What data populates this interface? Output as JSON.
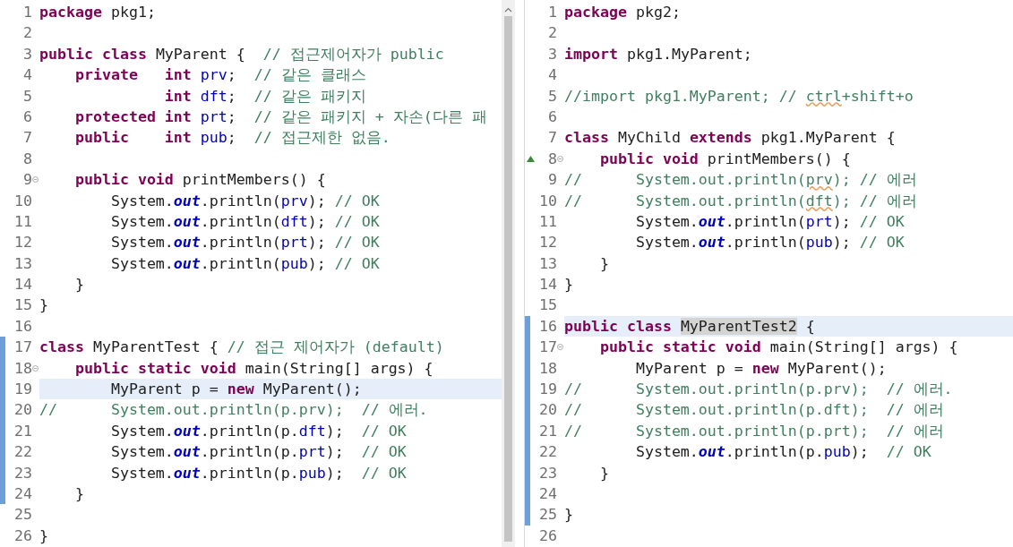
{
  "editors": [
    {
      "scrollbar": true,
      "lines": [
        {
          "number": "1",
          "highlighted": false,
          "changed": false,
          "fold": false,
          "override": false,
          "tokens": [
            {
              "kind": "keyword",
              "text": "package"
            },
            {
              "kind": "plain",
              "text": " pkg1;"
            }
          ]
        },
        {
          "number": "2",
          "highlighted": false,
          "changed": false,
          "fold": false,
          "override": false
        },
        {
          "number": "3",
          "highlighted": false,
          "changed": false,
          "fold": false,
          "override": false,
          "tokens": [
            {
              "kind": "keyword",
              "text": "public class"
            },
            {
              "kind": "plain",
              "text": " MyParent {  "
            },
            {
              "kind": "comment",
              "text": "// 접근제어자가 public"
            }
          ]
        },
        {
          "number": "4",
          "highlighted": false,
          "changed": false,
          "fold": false,
          "override": false,
          "tokens": [
            {
              "kind": "keyword",
              "text": "    private   int "
            },
            {
              "kind": "field",
              "text": "prv"
            },
            {
              "kind": "plain",
              "text": ";  "
            },
            {
              "kind": "comment",
              "text": "// 같은 클래스"
            }
          ]
        },
        {
          "number": "5",
          "highlighted": false,
          "changed": false,
          "fold": false,
          "override": false,
          "tokens": [
            {
              "kind": "keyword",
              "text": "              int "
            },
            {
              "kind": "field",
              "text": "dft"
            },
            {
              "kind": "plain",
              "text": ";  "
            },
            {
              "kind": "comment",
              "text": "// 같은 패키지"
            }
          ]
        },
        {
          "number": "6",
          "highlighted": false,
          "changed": false,
          "fold": false,
          "override": false,
          "tokens": [
            {
              "kind": "keyword",
              "text": "    protected int "
            },
            {
              "kind": "field",
              "text": "prt"
            },
            {
              "kind": "plain",
              "text": ";  "
            },
            {
              "kind": "comment",
              "text": "// 같은 패키지 + 자손(다른 패"
            }
          ]
        },
        {
          "number": "7",
          "highlighted": false,
          "changed": false,
          "fold": false,
          "override": false,
          "tokens": [
            {
              "kind": "keyword",
              "text": "    public    int "
            },
            {
              "kind": "field",
              "text": "pub"
            },
            {
              "kind": "plain",
              "text": ";  "
            },
            {
              "kind": "comment",
              "text": "// 접근제한 없음."
            }
          ]
        },
        {
          "number": "8",
          "highlighted": false,
          "changed": false,
          "fold": false,
          "override": false
        },
        {
          "number": "9",
          "highlighted": false,
          "changed": false,
          "fold": true,
          "override": false,
          "tokens": [
            {
              "kind": "keyword",
              "text": "    public void"
            },
            {
              "kind": "plain",
              "text": " printMembers() {"
            }
          ]
        },
        {
          "number": "10",
          "highlighted": false,
          "changed": false,
          "fold": false,
          "override": false,
          "tokens": [
            {
              "kind": "plain",
              "text": "        System."
            },
            {
              "kind": "static",
              "text": "out"
            },
            {
              "kind": "plain",
              "text": ".println("
            },
            {
              "kind": "field",
              "text": "prv"
            },
            {
              "kind": "plain",
              "text": "); "
            },
            {
              "kind": "comment",
              "text": "// OK"
            }
          ]
        },
        {
          "number": "11",
          "highlighted": false,
          "changed": false,
          "fold": false,
          "override": false,
          "tokens": [
            {
              "kind": "plain",
              "text": "        System."
            },
            {
              "kind": "static",
              "text": "out"
            },
            {
              "kind": "plain",
              "text": ".println("
            },
            {
              "kind": "field",
              "text": "dft"
            },
            {
              "kind": "plain",
              "text": "); "
            },
            {
              "kind": "comment",
              "text": "// OK"
            }
          ]
        },
        {
          "number": "12",
          "highlighted": false,
          "changed": false,
          "fold": false,
          "override": false,
          "tokens": [
            {
              "kind": "plain",
              "text": "        System."
            },
            {
              "kind": "static",
              "text": "out"
            },
            {
              "kind": "plain",
              "text": ".println("
            },
            {
              "kind": "field",
              "text": "prt"
            },
            {
              "kind": "plain",
              "text": "); "
            },
            {
              "kind": "comment",
              "text": "// OK"
            }
          ]
        },
        {
          "number": "13",
          "highlighted": false,
          "changed": false,
          "fold": false,
          "override": false,
          "tokens": [
            {
              "kind": "plain",
              "text": "        System."
            },
            {
              "kind": "static",
              "text": "out"
            },
            {
              "kind": "plain",
              "text": ".println("
            },
            {
              "kind": "field",
              "text": "pub"
            },
            {
              "kind": "plain",
              "text": "); "
            },
            {
              "kind": "comment",
              "text": "// OK"
            }
          ]
        },
        {
          "number": "14",
          "highlighted": false,
          "changed": false,
          "fold": false,
          "override": false,
          "tokens": [
            {
              "kind": "plain",
              "text": "    }"
            }
          ]
        },
        {
          "number": "15",
          "highlighted": false,
          "changed": false,
          "fold": false,
          "override": false,
          "tokens": [
            {
              "kind": "plain",
              "text": "}"
            }
          ]
        },
        {
          "number": "16",
          "highlighted": false,
          "changed": false,
          "fold": false,
          "override": false
        },
        {
          "number": "17",
          "highlighted": false,
          "changed": true,
          "fold": false,
          "override": false,
          "tokens": [
            {
              "kind": "keyword",
              "text": "class"
            },
            {
              "kind": "plain",
              "text": " MyParentTest { "
            },
            {
              "kind": "comment",
              "text": "// 접근 제어자가 (default)"
            }
          ]
        },
        {
          "number": "18",
          "highlighted": false,
          "changed": true,
          "fold": true,
          "override": false,
          "tokens": [
            {
              "kind": "keyword",
              "text": "    public static void"
            },
            {
              "kind": "plain",
              "text": " main(String[] args) {"
            }
          ]
        },
        {
          "number": "19",
          "highlighted": true,
          "changed": true,
          "fold": false,
          "override": false,
          "tokens": [
            {
              "kind": "plain",
              "text": "        MyParent p = "
            },
            {
              "kind": "keyword",
              "text": "new"
            },
            {
              "kind": "plain",
              "text": " MyParent();"
            }
          ]
        },
        {
          "number": "20",
          "highlighted": false,
          "changed": true,
          "fold": false,
          "override": false,
          "tokens": [
            {
              "kind": "comment",
              "text": "//      System.out.println(p.prv);  // 에러."
            }
          ]
        },
        {
          "number": "21",
          "highlighted": false,
          "changed": true,
          "fold": false,
          "override": false,
          "tokens": [
            {
              "kind": "plain",
              "text": "        System."
            },
            {
              "kind": "static",
              "text": "out"
            },
            {
              "kind": "plain",
              "text": ".println(p."
            },
            {
              "kind": "field",
              "text": "dft"
            },
            {
              "kind": "plain",
              "text": ");  "
            },
            {
              "kind": "comment",
              "text": "// OK"
            }
          ]
        },
        {
          "number": "22",
          "highlighted": false,
          "changed": true,
          "fold": false,
          "override": false,
          "tokens": [
            {
              "kind": "plain",
              "text": "        System."
            },
            {
              "kind": "static",
              "text": "out"
            },
            {
              "kind": "plain",
              "text": ".println(p."
            },
            {
              "kind": "field",
              "text": "prt"
            },
            {
              "kind": "plain",
              "text": ");  "
            },
            {
              "kind": "comment",
              "text": "// OK"
            }
          ]
        },
        {
          "number": "23",
          "highlighted": false,
          "changed": true,
          "fold": false,
          "override": false,
          "tokens": [
            {
              "kind": "plain",
              "text": "        System."
            },
            {
              "kind": "static",
              "text": "out"
            },
            {
              "kind": "plain",
              "text": ".println(p."
            },
            {
              "kind": "field",
              "text": "pub"
            },
            {
              "kind": "plain",
              "text": ");  "
            },
            {
              "kind": "comment",
              "text": "// OK"
            }
          ]
        },
        {
          "number": "24",
          "highlighted": false,
          "changed": true,
          "fold": false,
          "override": false,
          "tokens": [
            {
              "kind": "plain",
              "text": "    }"
            }
          ]
        },
        {
          "number": "25",
          "highlighted": false,
          "changed": false,
          "fold": false,
          "override": false
        },
        {
          "number": "26",
          "highlighted": false,
          "changed": false,
          "fold": false,
          "override": false,
          "tokens": [
            {
              "kind": "plain",
              "text": "}"
            }
          ]
        }
      ]
    },
    {
      "scrollbar": false,
      "lines": [
        {
          "number": "1",
          "highlighted": false,
          "changed": false,
          "fold": false,
          "override": false,
          "tokens": [
            {
              "kind": "keyword",
              "text": "package"
            },
            {
              "kind": "plain",
              "text": " pkg2;"
            }
          ]
        },
        {
          "number": "2",
          "highlighted": false,
          "changed": false,
          "fold": false,
          "override": false
        },
        {
          "number": "3",
          "highlighted": false,
          "changed": false,
          "fold": false,
          "override": false,
          "tokens": [
            {
              "kind": "keyword",
              "text": "import"
            },
            {
              "kind": "plain",
              "text": " pkg1.MyParent;"
            }
          ]
        },
        {
          "number": "4",
          "highlighted": false,
          "changed": false,
          "fold": false,
          "override": false
        },
        {
          "number": "5",
          "highlighted": false,
          "changed": false,
          "fold": false,
          "override": false,
          "tokens": [
            {
              "kind": "comment",
              "text": "//import pkg1.MyParent; // "
            },
            {
              "kind": "comment_flagged",
              "text": "ctrl"
            },
            {
              "kind": "comment",
              "text": "+shift+o"
            }
          ]
        },
        {
          "number": "6",
          "highlighted": false,
          "changed": false,
          "fold": false,
          "override": false
        },
        {
          "number": "7",
          "highlighted": false,
          "changed": false,
          "fold": false,
          "override": false,
          "tokens": [
            {
              "kind": "keyword",
              "text": "class"
            },
            {
              "kind": "plain",
              "text": " MyChild "
            },
            {
              "kind": "keyword",
              "text": "extends"
            },
            {
              "kind": "plain",
              "text": " pkg1.MyParent {"
            }
          ]
        },
        {
          "number": "8",
          "highlighted": false,
          "changed": false,
          "fold": true,
          "override": true,
          "tokens": [
            {
              "kind": "keyword",
              "text": "    public void"
            },
            {
              "kind": "plain",
              "text": " printMembers() {"
            }
          ]
        },
        {
          "number": "9",
          "highlighted": false,
          "changed": false,
          "fold": false,
          "override": false,
          "tokens": [
            {
              "kind": "comment",
              "text": "//      System.out.println("
            },
            {
              "kind": "comment_flagged",
              "text": "prv"
            },
            {
              "kind": "comment",
              "text": "); // 에러"
            }
          ]
        },
        {
          "number": "10",
          "highlighted": false,
          "changed": false,
          "fold": false,
          "override": false,
          "tokens": [
            {
              "kind": "comment",
              "text": "//      System.out.println("
            },
            {
              "kind": "comment_flagged",
              "text": "dft"
            },
            {
              "kind": "comment",
              "text": "); // 에러"
            }
          ]
        },
        {
          "number": "11",
          "highlighted": false,
          "changed": false,
          "fold": false,
          "override": false,
          "tokens": [
            {
              "kind": "plain",
              "text": "        System."
            },
            {
              "kind": "static",
              "text": "out"
            },
            {
              "kind": "plain",
              "text": ".println("
            },
            {
              "kind": "field",
              "text": "prt"
            },
            {
              "kind": "plain",
              "text": "); "
            },
            {
              "kind": "comment",
              "text": "// OK"
            }
          ]
        },
        {
          "number": "12",
          "highlighted": false,
          "changed": false,
          "fold": false,
          "override": false,
          "tokens": [
            {
              "kind": "plain",
              "text": "        System."
            },
            {
              "kind": "static",
              "text": "out"
            },
            {
              "kind": "plain",
              "text": ".println("
            },
            {
              "kind": "field",
              "text": "pub"
            },
            {
              "kind": "plain",
              "text": "); "
            },
            {
              "kind": "comment",
              "text": "// OK"
            }
          ]
        },
        {
          "number": "13",
          "highlighted": false,
          "changed": false,
          "fold": false,
          "override": false,
          "tokens": [
            {
              "kind": "plain",
              "text": "    }"
            }
          ]
        },
        {
          "number": "14",
          "highlighted": false,
          "changed": false,
          "fold": false,
          "override": false,
          "tokens": [
            {
              "kind": "plain",
              "text": "}"
            }
          ]
        },
        {
          "number": "15",
          "highlighted": false,
          "changed": false,
          "fold": false,
          "override": false
        },
        {
          "number": "16",
          "highlighted": true,
          "changed": true,
          "fold": false,
          "override": false,
          "tokens": [
            {
              "kind": "keyword",
              "text": "public class "
            },
            {
              "kind": "occurrence",
              "text": "MyParentTest2"
            },
            {
              "kind": "plain",
              "text": " {"
            }
          ]
        },
        {
          "number": "17",
          "highlighted": false,
          "changed": true,
          "fold": true,
          "override": false,
          "tokens": [
            {
              "kind": "keyword",
              "text": "    public static void"
            },
            {
              "kind": "plain",
              "text": " main(String[] args) {"
            }
          ]
        },
        {
          "number": "18",
          "highlighted": false,
          "changed": true,
          "fold": false,
          "override": false,
          "tokens": [
            {
              "kind": "plain",
              "text": "        MyParent p = "
            },
            {
              "kind": "keyword",
              "text": "new"
            },
            {
              "kind": "plain",
              "text": " MyParent();"
            }
          ]
        },
        {
          "number": "19",
          "highlighted": false,
          "changed": true,
          "fold": false,
          "override": false,
          "tokens": [
            {
              "kind": "comment",
              "text": "//      System.out.println(p.prv);  // 에러."
            }
          ]
        },
        {
          "number": "20",
          "highlighted": false,
          "changed": true,
          "fold": false,
          "override": false,
          "tokens": [
            {
              "kind": "comment",
              "text": "//      System.out.println(p.dft);  // 에러"
            }
          ]
        },
        {
          "number": "21",
          "highlighted": false,
          "changed": true,
          "fold": false,
          "override": false,
          "tokens": [
            {
              "kind": "comment",
              "text": "//      System.out.println(p.prt);  // 에러"
            }
          ]
        },
        {
          "number": "22",
          "highlighted": false,
          "changed": true,
          "fold": false,
          "override": false,
          "tokens": [
            {
              "kind": "plain",
              "text": "        System."
            },
            {
              "kind": "static",
              "text": "out"
            },
            {
              "kind": "plain",
              "text": ".println(p."
            },
            {
              "kind": "field",
              "text": "pub"
            },
            {
              "kind": "plain",
              "text": ");  "
            },
            {
              "kind": "comment",
              "text": "// OK"
            }
          ]
        },
        {
          "number": "23",
          "highlighted": false,
          "changed": true,
          "fold": false,
          "override": false,
          "tokens": [
            {
              "kind": "plain",
              "text": "    }"
            }
          ]
        },
        {
          "number": "24",
          "highlighted": false,
          "changed": true,
          "fold": false,
          "override": false
        },
        {
          "number": "25",
          "highlighted": false,
          "changed": true,
          "fold": false,
          "override": false,
          "tokens": [
            {
              "kind": "plain",
              "text": "}"
            }
          ]
        },
        {
          "number": "26",
          "highlighted": false,
          "changed": false,
          "fold": false,
          "override": false
        }
      ]
    }
  ]
}
